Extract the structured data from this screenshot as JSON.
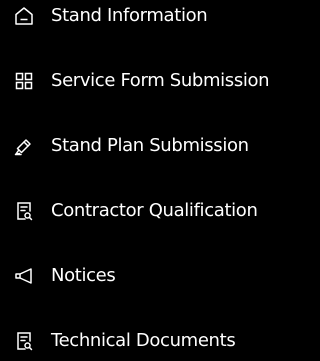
{
  "menu": {
    "items": [
      {
        "label": "Stand Information",
        "icon": "home-icon"
      },
      {
        "label": "Service Form Submission",
        "icon": "grid-icon"
      },
      {
        "label": "Stand Plan Submission",
        "icon": "pen-icon"
      },
      {
        "label": "Contractor Qualification",
        "icon": "document-search-icon"
      },
      {
        "label": "Notices",
        "icon": "megaphone-icon"
      },
      {
        "label": "Technical Documents",
        "icon": "document-search-icon"
      }
    ]
  },
  "colors": {
    "background": "#000000",
    "foreground": "#ffffff"
  }
}
